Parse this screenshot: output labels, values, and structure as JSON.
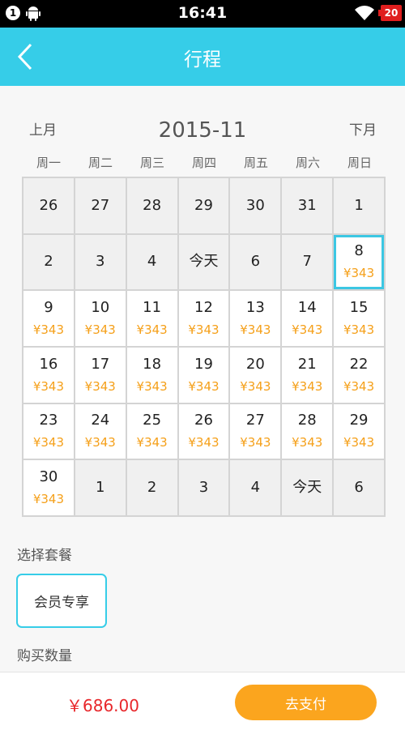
{
  "status_bar": {
    "notification_count": "1",
    "time": "16:41",
    "battery": "20"
  },
  "header": {
    "title": "行程",
    "back_icon": "chevron-left-icon"
  },
  "calendar": {
    "prev_label": "上月",
    "next_label": "下月",
    "month": "2015-11",
    "weekdays": [
      "周一",
      "周二",
      "周三",
      "周四",
      "周五",
      "周六",
      "周日"
    ],
    "days": [
      {
        "label": "26",
        "price": "",
        "state": "disabled"
      },
      {
        "label": "27",
        "price": "",
        "state": "disabled"
      },
      {
        "label": "28",
        "price": "",
        "state": "disabled"
      },
      {
        "label": "29",
        "price": "",
        "state": "disabled"
      },
      {
        "label": "30",
        "price": "",
        "state": "disabled"
      },
      {
        "label": "31",
        "price": "",
        "state": "disabled"
      },
      {
        "label": "1",
        "price": "",
        "state": "disabled"
      },
      {
        "label": "2",
        "price": "",
        "state": "disabled"
      },
      {
        "label": "3",
        "price": "",
        "state": "disabled"
      },
      {
        "label": "4",
        "price": "",
        "state": "disabled"
      },
      {
        "label": "今天",
        "price": "",
        "state": "disabled"
      },
      {
        "label": "6",
        "price": "",
        "state": "disabled"
      },
      {
        "label": "7",
        "price": "",
        "state": "disabled"
      },
      {
        "label": "8",
        "price": "¥343",
        "state": "selected"
      },
      {
        "label": "9",
        "price": "¥343",
        "state": "available"
      },
      {
        "label": "10",
        "price": "¥343",
        "state": "available"
      },
      {
        "label": "11",
        "price": "¥343",
        "state": "available"
      },
      {
        "label": "12",
        "price": "¥343",
        "state": "available"
      },
      {
        "label": "13",
        "price": "¥343",
        "state": "available"
      },
      {
        "label": "14",
        "price": "¥343",
        "state": "available"
      },
      {
        "label": "15",
        "price": "¥343",
        "state": "available"
      },
      {
        "label": "16",
        "price": "¥343",
        "state": "available"
      },
      {
        "label": "17",
        "price": "¥343",
        "state": "available"
      },
      {
        "label": "18",
        "price": "¥343",
        "state": "available"
      },
      {
        "label": "19",
        "price": "¥343",
        "state": "available"
      },
      {
        "label": "20",
        "price": "¥343",
        "state": "available"
      },
      {
        "label": "21",
        "price": "¥343",
        "state": "available"
      },
      {
        "label": "22",
        "price": "¥343",
        "state": "available"
      },
      {
        "label": "23",
        "price": "¥343",
        "state": "available"
      },
      {
        "label": "24",
        "price": "¥343",
        "state": "available"
      },
      {
        "label": "25",
        "price": "¥343",
        "state": "available"
      },
      {
        "label": "26",
        "price": "¥343",
        "state": "available"
      },
      {
        "label": "27",
        "price": "¥343",
        "state": "available"
      },
      {
        "label": "28",
        "price": "¥343",
        "state": "available"
      },
      {
        "label": "29",
        "price": "¥343",
        "state": "available"
      },
      {
        "label": "30",
        "price": "¥343",
        "state": "available"
      },
      {
        "label": "1",
        "price": "",
        "state": "disabled"
      },
      {
        "label": "2",
        "price": "",
        "state": "disabled"
      },
      {
        "label": "3",
        "price": "",
        "state": "disabled"
      },
      {
        "label": "4",
        "price": "",
        "state": "disabled"
      },
      {
        "label": "今天",
        "price": "",
        "state": "disabled"
      },
      {
        "label": "6",
        "price": "",
        "state": "disabled"
      }
    ]
  },
  "package": {
    "label": "选择套餐",
    "option": "会员专享"
  },
  "quantity": {
    "label": "购买数量"
  },
  "footer": {
    "total": "￥686.00",
    "pay_label": "去支付"
  },
  "colors": {
    "accent": "#36cde8",
    "price": "#f5a01a",
    "total": "#e8272b",
    "pay_button": "#fba51e"
  }
}
